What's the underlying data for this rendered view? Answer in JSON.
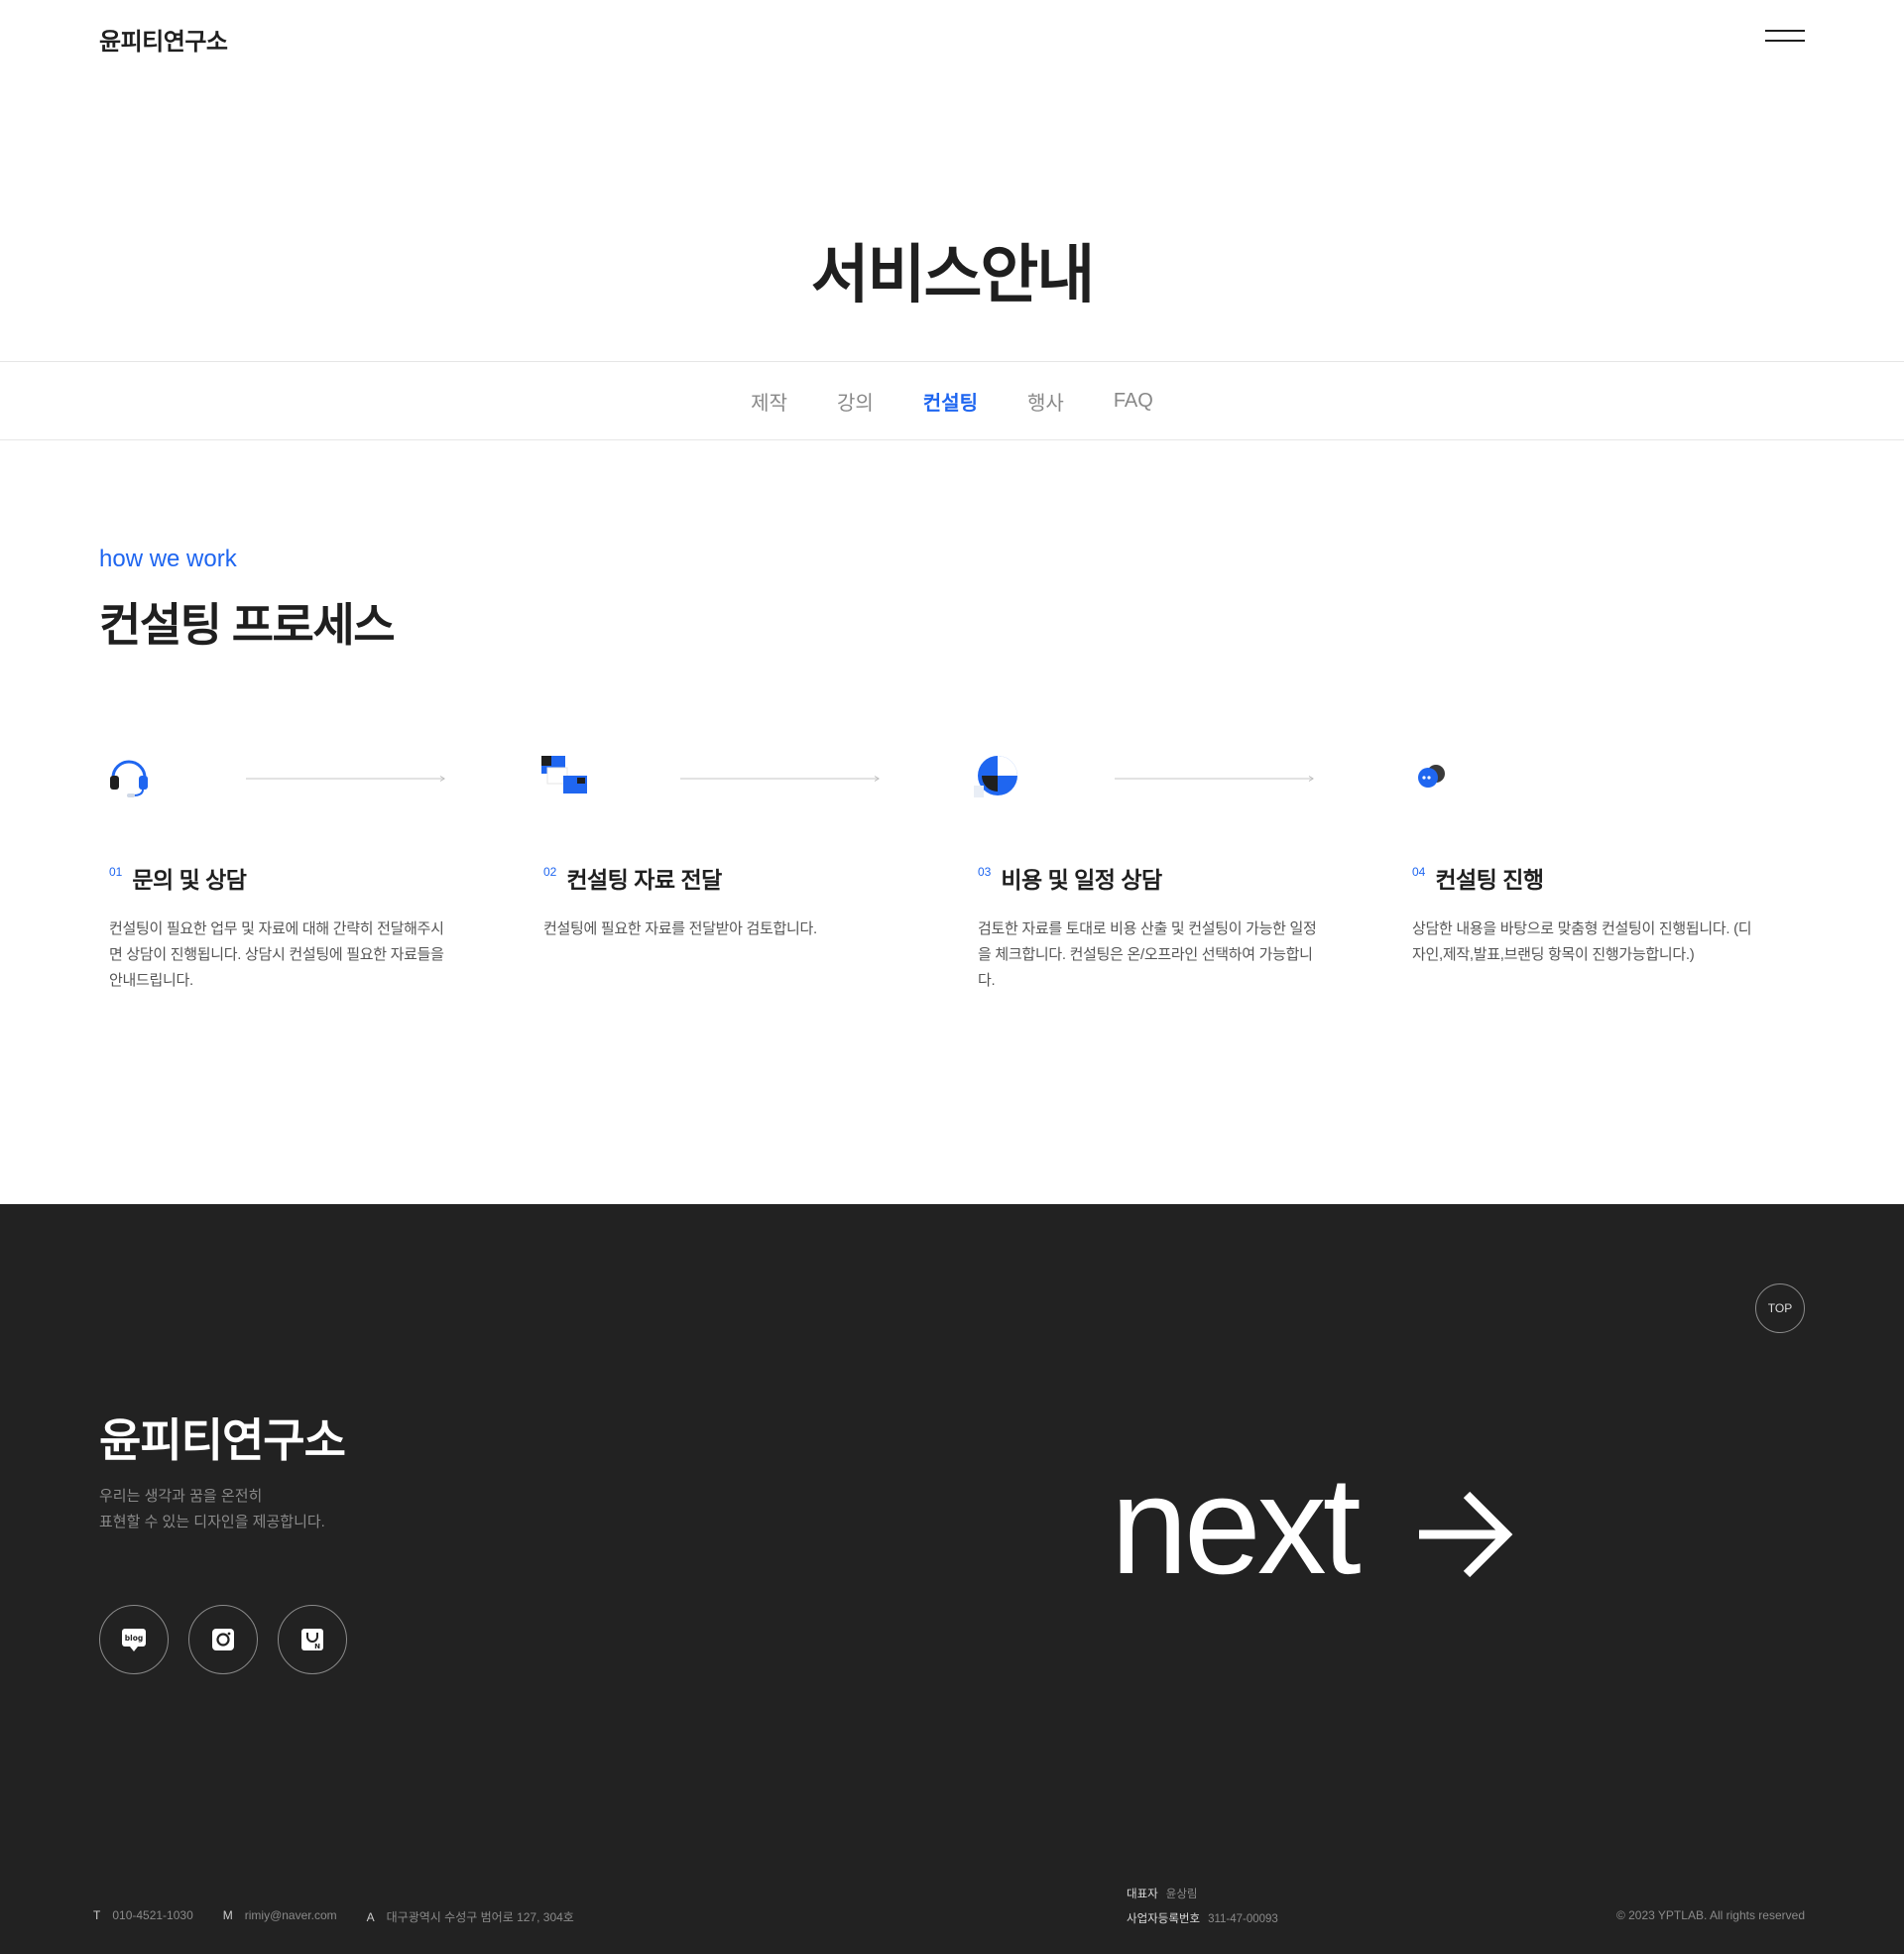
{
  "header": {
    "logo": "윤피티연구소"
  },
  "hero": {
    "title": "서비스안내"
  },
  "tabs": [
    {
      "label": "제작",
      "active": false
    },
    {
      "label": "강의",
      "active": false
    },
    {
      "label": "컨설팅",
      "active": true
    },
    {
      "label": "행사",
      "active": false
    },
    {
      "label": "FAQ",
      "active": false
    }
  ],
  "section": {
    "eyebrow": "how we work",
    "title": "컨설팅 프로세스"
  },
  "steps": [
    {
      "num": "01",
      "title": "문의 및 상담",
      "desc": "컨설팅이 필요한 업무 및 자료에 대해 간략히 전달해주시면 상담이 진행됩니다. 상담시 컨설팅에 필요한 자료들을 안내드립니다.",
      "icon": "headset-icon"
    },
    {
      "num": "02",
      "title": "컨설팅 자료 전달",
      "desc": "컨설팅에 필요한 자료를 전달받아 검토합니다.",
      "icon": "files-transfer-icon"
    },
    {
      "num": "03",
      "title": "비용 및 일정 상담",
      "desc": "검토한 자료를 토대로 비용 산출 및 컨설팅이 가능한 일정을 체크합니다. 컨설팅은 온/오프라인 선택하여 가능합니다.",
      "icon": "pie-chart-icon"
    },
    {
      "num": "04",
      "title": "컨설팅 진행",
      "desc": "상담한 내용을 바탕으로 맞춤형 컨설팅이 진행됩니다. (디자인,제작,발표,브랜딩 항목이 진행가능합니다.)",
      "icon": "chat-bubbles-icon"
    }
  ],
  "footer": {
    "top_label": "TOP",
    "logo": "윤피티연구소",
    "tagline_1": "우리는 생각과 꿈을 온전히",
    "tagline_2": "표현할 수 있는 디자인을 제공합니다.",
    "next_label": "next",
    "socials": [
      "blog-icon",
      "instagram-icon",
      "naver-store-icon"
    ],
    "contact": {
      "t_label": "T",
      "t_value": "010-4521-1030",
      "m_label": "M",
      "m_value": "rimiy@naver.com",
      "a_label": "A",
      "a_value": "대구광역시 수성구 범어로 127, 304호"
    },
    "biz": {
      "ceo_label": "대표자",
      "ceo_value": "윤상림",
      "reg_label": "사업자등록번호",
      "reg_value": "311-47-00093"
    },
    "copyright": "© 2023 YPTLAB. All rights reserved"
  },
  "colors": {
    "accent": "#1f66f0",
    "footer_bg": "#222222"
  }
}
